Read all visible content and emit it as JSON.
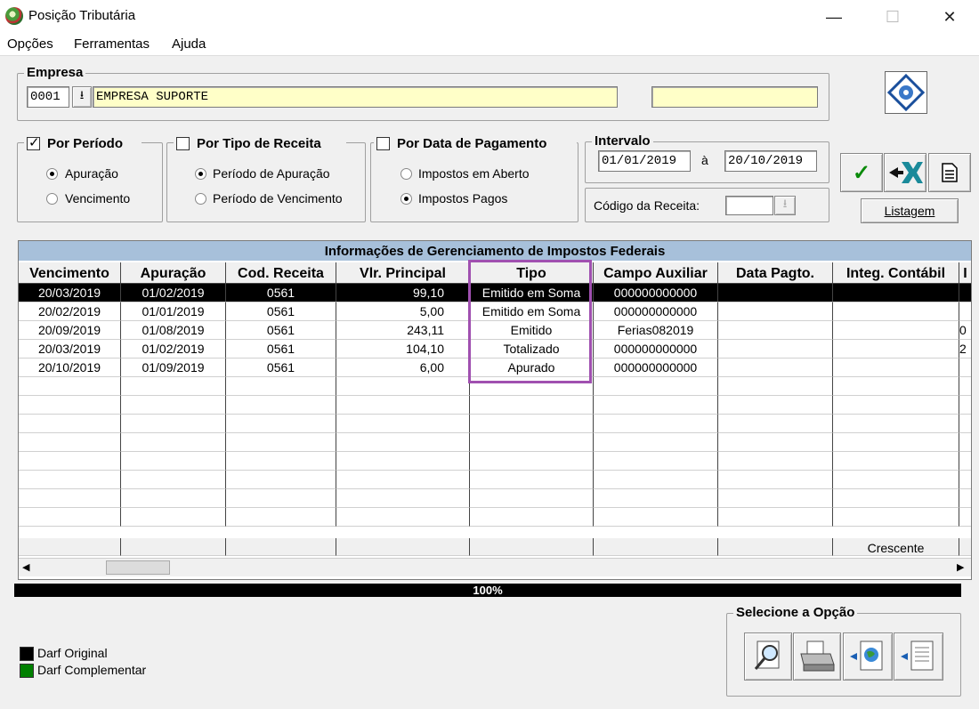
{
  "window": {
    "title": "Posição Tributária",
    "minimize": "—",
    "maximize": "☐",
    "close": "✕"
  },
  "menu": [
    "Opções",
    "Ferramentas",
    "Ajuda"
  ],
  "empresa": {
    "legend": "Empresa",
    "code": "0001",
    "name": "EMPRESA SUPORTE",
    "extra": ""
  },
  "por_periodo": {
    "label": "Por Período",
    "checked": true,
    "opt1": "Apuração",
    "opt2": "Vencimento"
  },
  "por_tipo": {
    "label": "Por Tipo de Receita",
    "opt1": "Período de Apuração",
    "opt2": "Período de Vencimento"
  },
  "por_data": {
    "label": "Por Data de Pagamento",
    "opt1": "Impostos em Aberto",
    "opt2": "Impostos Pagos"
  },
  "intervalo": {
    "label": "Intervalo",
    "start": "01/01/2019",
    "sep": "à",
    "end": "20/10/2019"
  },
  "codigo_receita": {
    "label": "Código da Receita:",
    "value": ""
  },
  "listagem_label": "Listagem",
  "grid": {
    "title": "Informações de Gerenciamento de Impostos Federais",
    "columns": [
      "Vencimento",
      "Apuração",
      "Cod. Receita",
      "Vlr. Principal",
      "Tipo",
      "Campo Auxiliar",
      "Data Pagto.",
      "Integ. Contábil",
      "I"
    ],
    "rows": [
      [
        "20/03/2019",
        "01/02/2019",
        "0561",
        "99,10",
        "Emitido em Soma",
        "000000000000",
        "",
        "",
        ""
      ],
      [
        "20/02/2019",
        "01/01/2019",
        "0561",
        "5,00",
        "Emitido em Soma",
        "000000000000",
        "",
        "",
        ""
      ],
      [
        "20/09/2019",
        "01/08/2019",
        "0561",
        "243,11",
        "Emitido",
        "Ferias082019",
        "",
        "",
        "0"
      ],
      [
        "20/03/2019",
        "01/02/2019",
        "0561",
        "104,10",
        "Totalizado",
        "000000000000",
        "",
        "",
        "2"
      ],
      [
        "20/10/2019",
        "01/09/2019",
        "0561",
        "6,00",
        "Apurado",
        "000000000000",
        "",
        "",
        ""
      ]
    ],
    "sort_label": "Crescente"
  },
  "progress": "100%",
  "selecione": {
    "legend": "Selecione a Opção"
  },
  "legend_items": [
    {
      "label": "Darf Original",
      "color": "#000000"
    },
    {
      "label": "Darf Complementar",
      "color": "#008000"
    }
  ],
  "highlight_color": "#a050b0"
}
